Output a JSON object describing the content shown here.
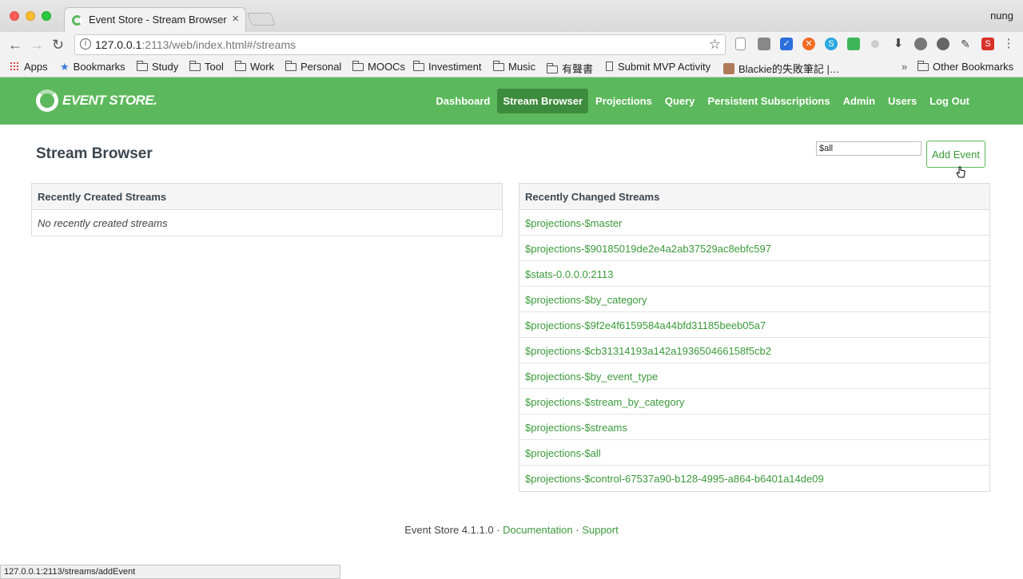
{
  "browser": {
    "tab_title": "Event Store - Stream Browser",
    "user": "nung",
    "url_host": "127.0.0.1",
    "url_rest": ":2113/web/index.html#/streams",
    "bookmarks": [
      "Apps",
      "Bookmarks",
      "Study",
      "Tool",
      "Work",
      "Personal",
      "MOOCs",
      "Investiment",
      "Music",
      "有聲書",
      "Submit MVP Activity",
      "Blackie的失敗筆記 |…",
      "Other Bookmarks"
    ],
    "bookmarks_more": "»",
    "status_url": "127.0.0.1:2113/streams/addEvent"
  },
  "nav": {
    "logo_text": "EVENT STORE.",
    "links": [
      "Dashboard",
      "Stream Browser",
      "Projections",
      "Query",
      "Persistent Subscriptions",
      "Admin",
      "Users",
      "Log Out"
    ],
    "active": "Stream Browser"
  },
  "page": {
    "title": "Stream Browser",
    "stream_input_value": "$all",
    "add_event_label": "Add Event"
  },
  "recently_created": {
    "heading": "Recently Created Streams",
    "empty_text": "No recently created streams"
  },
  "recently_changed": {
    "heading": "Recently Changed Streams",
    "streams": [
      "$projections-$master",
      "$projections-$90185019de2e4a2ab37529ac8ebfc597",
      "$stats-0.0.0.0:2113",
      "$projections-$by_category",
      "$projections-$9f2e4f6159584a44bfd31185beeb05a7",
      "$projections-$cb31314193a142a193650466158f5cb2",
      "$projections-$by_event_type",
      "$projections-$stream_by_category",
      "$projections-$streams",
      "$projections-$all",
      "$projections-$control-67537a90-b128-4995-a864-b6401a14de09"
    ]
  },
  "footer": {
    "version": "Event Store 4.1.1.0",
    "sep": "·",
    "documentation": "Documentation",
    "support": "Support"
  },
  "colors": {
    "brand_green": "#5cb85c",
    "active_green": "#3d8b3d",
    "link_green": "#3a9a3a"
  }
}
